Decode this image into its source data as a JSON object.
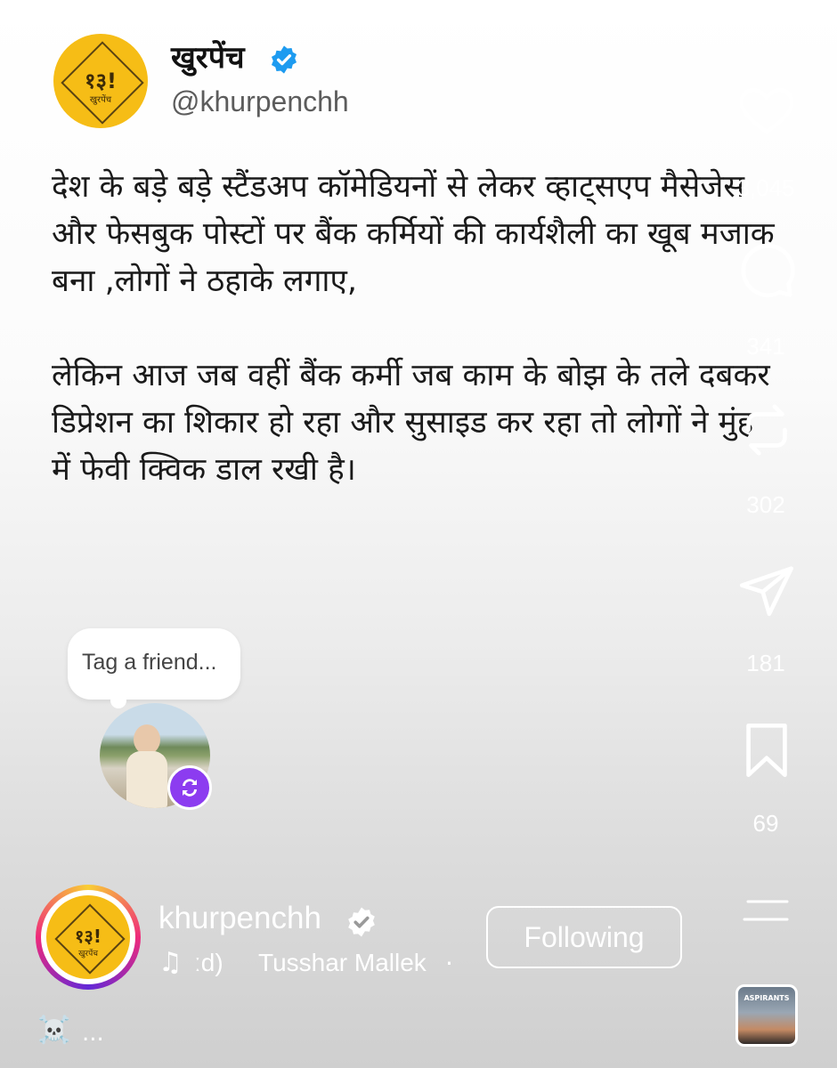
{
  "post": {
    "display_name": "खुरपेंच",
    "handle": "@khurpenchh",
    "logo_text": "१३!",
    "logo_sub": "खुरपेंच",
    "paragraph1": "देश के बड़े बड़े स्टैंडअप कॉमेडियनों से लेकर व्हाट्सएप मैसेजेस और फेसबुक पोस्टों पर बैंक कर्मियों की कार्यशैली का खूब मजाक बना ,लोगों ने ठहाके लगाए,",
    "paragraph2": "लेकिन आज जब वहीं बैंक कर्मी जब काम के बोझ के तले दबकर डिप्रेशन का शिकार हो रहा और सुसाइड कर रहा तो लोगों ने मुंह में फेवी क्विक डाल रखी है।"
  },
  "rail": {
    "likes": "3,045",
    "comments": "341",
    "reposts": "302",
    "shares": "181",
    "saves": "69",
    "icons": [
      "heart-icon",
      "comment-icon",
      "repost-icon",
      "send-icon",
      "bookmark-icon",
      "menu-icon"
    ]
  },
  "tag": {
    "bubble_text": "Tag a friend..."
  },
  "footer": {
    "username": "khurpenchh",
    "music_note": "♫",
    "music_partial": "ːd)",
    "music_artist": "Tusshar Mallek",
    "music_separator": "·",
    "follow_label": "Following",
    "album_text": "ASPIRANTS",
    "skull": "☠️",
    "more": "..."
  },
  "colors": {
    "brand_yellow": "#f6bd16",
    "verified_blue": "#1d9bf0",
    "repost_purple": "#8c3cf0"
  }
}
